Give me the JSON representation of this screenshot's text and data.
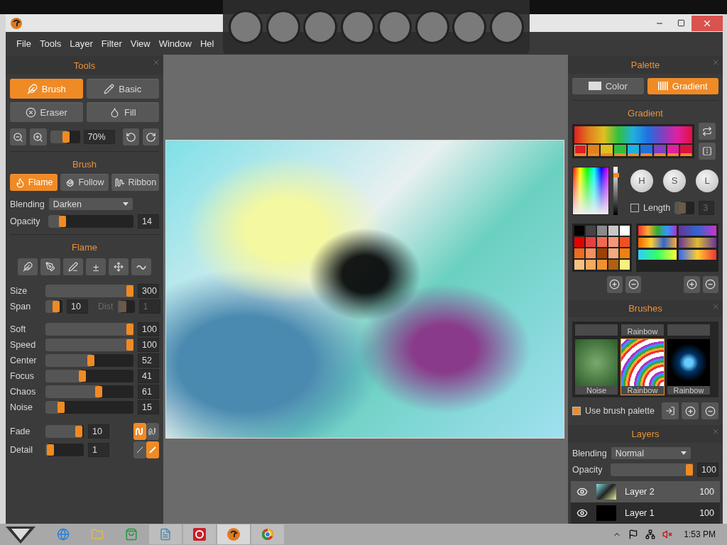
{
  "menu": [
    "File",
    "Tools",
    "Layer",
    "Filter",
    "View",
    "Window",
    "Hel"
  ],
  "tools": {
    "title": "Tools",
    "buttons": [
      {
        "label": "Brush",
        "kind": "brush",
        "selected": true
      },
      {
        "label": "Basic",
        "kind": "pencil",
        "selected": false
      },
      {
        "label": "Eraser",
        "kind": "eraser",
        "selected": false
      },
      {
        "label": "Fill",
        "kind": "fill",
        "selected": false
      }
    ],
    "zoom": {
      "level": 0.55,
      "value": "70%"
    }
  },
  "brush": {
    "title": "Brush",
    "modes": [
      {
        "label": "Flame",
        "kind": "flame",
        "selected": true
      },
      {
        "label": "Follow",
        "kind": "spiral",
        "selected": false
      },
      {
        "label": "Ribbon",
        "kind": "ribbon",
        "selected": false
      }
    ],
    "blending": "Darken",
    "opacity": {
      "label": "Opacity",
      "level": 0.14,
      "value": "14"
    },
    "blending_label": "Blending"
  },
  "flame": {
    "title": "Flame",
    "icons": [
      {
        "kind": "feather"
      },
      {
        "kind": "pen"
      },
      {
        "kind": "pen-alt"
      },
      {
        "kind": "text",
        "text": "±"
      },
      {
        "kind": "expand"
      },
      {
        "kind": "wave"
      }
    ],
    "groups": [
      [
        {
          "kind": "wide",
          "label": "Size",
          "level": 1,
          "value": "300"
        },
        {
          "kind": "split",
          "label": "Span",
          "level": 0.7,
          "value": "10",
          "second": {
            "label": "Dist",
            "level": 0.2,
            "value": "1",
            "disabled": true
          }
        }
      ],
      [
        {
          "kind": "wide",
          "label": "Soft",
          "level": 1,
          "value": "100"
        },
        {
          "kind": "wide",
          "label": "Speed",
          "level": 1,
          "value": "100"
        },
        {
          "kind": "wide",
          "label": "Center",
          "level": 0.52,
          "value": "52"
        },
        {
          "kind": "wide",
          "label": "Focus",
          "level": 0.41,
          "value": "41"
        },
        {
          "kind": "wide",
          "label": "Chaos",
          "level": 0.61,
          "value": "61"
        },
        {
          "kind": "wide",
          "label": "Noise",
          "level": 0.15,
          "value": "15"
        }
      ],
      [
        {
          "kind": "short",
          "label": "Fade",
          "level": 0.95,
          "value": "10",
          "toggles": [
            {
              "kind": "wave",
              "selected": true
            },
            {
              "kind": "wave-outline",
              "selected": false
            }
          ]
        },
        {
          "kind": "short",
          "label": "Detail",
          "level": 0.05,
          "value": "1",
          "toggles": [
            {
              "kind": "thin-line",
              "selected": false
            },
            {
              "kind": "thick-line",
              "selected": true
            }
          ]
        }
      ]
    ]
  },
  "palette": {
    "title": "Palette",
    "tabs": [
      {
        "label": "Color",
        "kind": "color",
        "selected": false
      },
      {
        "label": "Gradient",
        "kind": "gradient",
        "selected": true
      }
    ],
    "gradient_title": "Gradient",
    "stops": [
      {
        "color": "#e02020",
        "selected": true
      },
      {
        "color": "#e08020",
        "selected": false
      },
      {
        "color": "#e0c020",
        "selected": false
      },
      {
        "color": "#30c040",
        "selected": false
      },
      {
        "color": "#20b0e0",
        "selected": false
      },
      {
        "color": "#2070e0",
        "selected": false
      },
      {
        "color": "#8040c0",
        "selected": false
      },
      {
        "color": "#e020a0",
        "selected": false
      },
      {
        "color": "#e01040",
        "selected": false
      }
    ],
    "lightness": {
      "level": 0.85
    },
    "knobs": [
      "H",
      "S",
      "L"
    ],
    "length": {
      "label": "Length",
      "checked": false,
      "value": "3",
      "level": 0.3
    },
    "swatches": [
      {
        "color": "#000000"
      },
      {
        "color": "#444444"
      },
      {
        "color": "#8a8a8a"
      },
      {
        "color": "#c8c8c8"
      },
      {
        "color": "#ffffff"
      },
      {
        "color": "#e60000"
      },
      {
        "color": "#e84040"
      },
      {
        "color": "#f06a50"
      },
      {
        "color": "#f4967a"
      },
      {
        "color": "#f05020"
      },
      {
        "color": "#f06a20"
      },
      {
        "color": "#f49060"
      },
      {
        "color": "#a04000"
      },
      {
        "color": "#f4aa80"
      },
      {
        "color": "#f08010"
      },
      {
        "color": "#f8c080"
      },
      {
        "color": "#f8a860"
      },
      {
        "color": "#f09030"
      },
      {
        "color": "#b06010"
      },
      {
        "color": "#f8f080"
      }
    ]
  },
  "brushes": {
    "title": "Brushes",
    "top_label": "Rainbow",
    "items": [
      {
        "label": "Noise",
        "kind": "noise",
        "selected": false
      },
      {
        "label": "Rainbow",
        "kind": "rainbow",
        "selected": true
      },
      {
        "label": "Rainbow",
        "kind": "sparks",
        "selected": false
      }
    ],
    "use_palette": {
      "label": "Use brush palette",
      "checked": true
    }
  },
  "layers": {
    "title": "Layers",
    "blending_label": "Blending",
    "blending": "Normal",
    "opacity": {
      "label": "Opacity",
      "level": 1,
      "value": "100"
    },
    "items": [
      {
        "name": "Layer 2",
        "opacity": "100",
        "kind": "painting",
        "visible": true,
        "selected": true
      },
      {
        "name": "Layer 1",
        "opacity": "100",
        "kind": "black",
        "visible": true,
        "selected": false
      }
    ]
  },
  "taskbar": {
    "apps": [
      {
        "kind": "browser",
        "open": false,
        "selected": false
      },
      {
        "kind": "folder",
        "open": false,
        "selected": false
      },
      {
        "kind": "store",
        "open": false,
        "selected": false
      },
      {
        "kind": "notepad",
        "open": true,
        "selected": false
      },
      {
        "kind": "red-app",
        "open": true,
        "selected": false
      },
      {
        "kind": "paint-app",
        "open": true,
        "selected": true
      },
      {
        "kind": "globe",
        "open": true,
        "selected": false
      }
    ],
    "time": "1:53 PM"
  }
}
